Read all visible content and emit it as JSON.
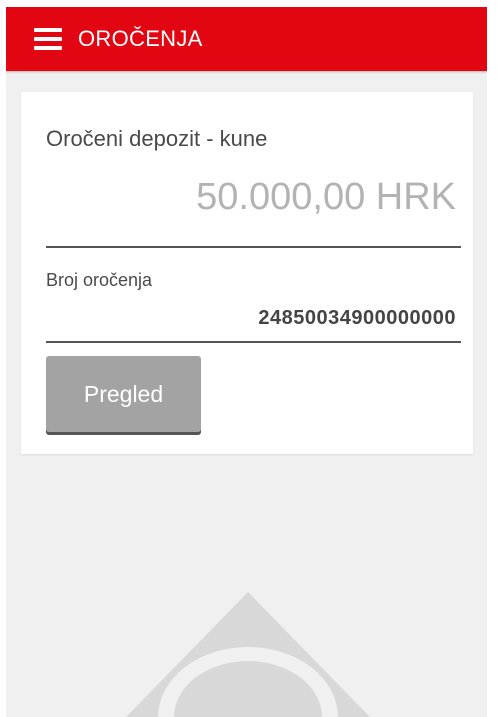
{
  "header": {
    "title": "OROČENJA",
    "menu_icon": "hamburger-menu-icon"
  },
  "card": {
    "deposit_name": "Oročeni depozit - kune",
    "amount": "50.000,00 HRK",
    "number_label": "Broj oročenja",
    "number_value": "24850034900000000",
    "button_label": "Pregled"
  },
  "colors": {
    "brand_red": "#e20613",
    "background": "#f0f0f0",
    "button_gray": "#a3a3a3",
    "amount_gray": "#b3b3b3"
  }
}
